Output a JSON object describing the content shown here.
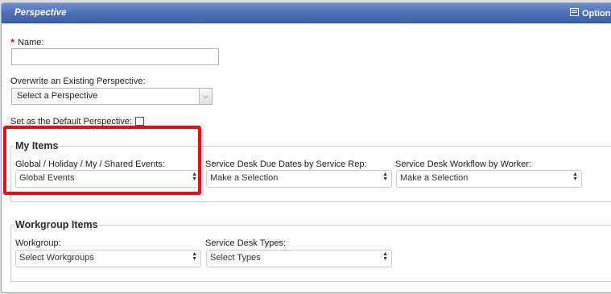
{
  "window": {
    "title": "Perspective",
    "options_label": "Option"
  },
  "form": {
    "name_label": "Name:",
    "name_value": "",
    "overwrite_label": "Overwrite an Existing Perspective:",
    "overwrite_value": "Select a Perspective",
    "default_label": "Set as the Default Perspective:",
    "default_checked": false
  },
  "my_items": {
    "title": "My Items",
    "fields": [
      {
        "label": "Global / Holiday / My / Shared Events:",
        "value": "Global Events"
      },
      {
        "label": "Service Desk Due Dates by Service Rep:",
        "value": "Make a Selection"
      },
      {
        "label": "Service Desk Workflow by Worker:",
        "value": "Make a Selection"
      }
    ]
  },
  "workgroup_items": {
    "title": "Workgroup Items",
    "fields": [
      {
        "label": "Workgroup:",
        "value": "Select Workgroups"
      },
      {
        "label": "Service Desk Types:",
        "value": "Select Types"
      }
    ]
  },
  "colors": {
    "titlebar": "#4a6db3",
    "highlight": "#d9141b",
    "required": "#c31b1b"
  }
}
